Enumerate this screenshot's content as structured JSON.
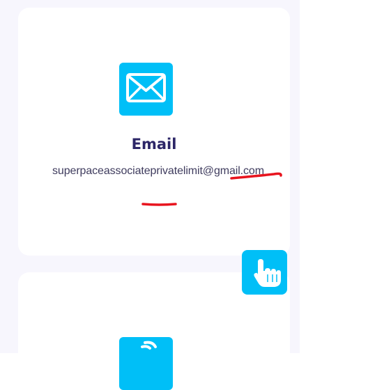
{
  "contact_card": {
    "icon": "envelope-icon",
    "title": "Email",
    "value": "superpaceassociateprivatelimit@gmail.com"
  },
  "next_card": {
    "icon": "phone-icon"
  },
  "floating_button": {
    "icon": "hand-pointer-icon"
  },
  "colors": {
    "accent": "#00bff7",
    "title": "#2c2667",
    "text": "#3f3c5e",
    "panel_bg": "#f7f6fd",
    "annotation": "#e8141e"
  }
}
